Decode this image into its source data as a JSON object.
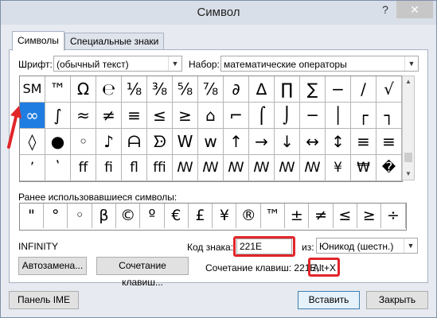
{
  "window": {
    "title": "Символ",
    "help": "?",
    "close": "✕"
  },
  "tabs": [
    {
      "label": "Символы"
    },
    {
      "label": "Специальные знаки"
    }
  ],
  "font": {
    "label": "Шрифт:",
    "value": "(обычный текст)"
  },
  "subset": {
    "label": "Набор:",
    "value": "математические операторы"
  },
  "grid": {
    "rows": [
      [
        "SM",
        "™",
        "Ω",
        "℮",
        "⅛",
        "⅜",
        "⅝",
        "⅞",
        "∂",
        "∆",
        "∏",
        "∑",
        "−",
        "∕",
        "√"
      ],
      [
        "∞",
        "∫",
        "≈",
        "≠",
        "≡",
        "≤",
        "≥",
        "⌂",
        "⌐",
        "⌠",
        "⌡",
        "─",
        "│",
        "┌",
        "┐"
      ],
      [
        "└",
        "┘",
        "├",
        "┤",
        "┬",
        "┴",
        "┼",
        "═",
        "║",
        "╒",
        "╓",
        "╔",
        "╕",
        "╖",
        "╗"
      ],
      [
        "◊",
        "●",
        "◦",
        "♪",
        "ᗩ",
        "ᗦ",
        "W",
        "w",
        "↑",
        "→",
        "↓",
        "↔",
        "↕",
        "≡",
        "≡"
      ],
      [
        "ʼ",
        "ʽ",
        "ff",
        "fi",
        "fl",
        "ffi",
        "ꟿ",
        "ꟿ",
        "ꟿ",
        "ꟿ",
        "ꟿ",
        "ꟿ",
        "¥",
        "₩",
        "�"
      ]
    ],
    "selected": "∞"
  },
  "recent": {
    "label": "Ранее использовавшиеся символы:",
    "items": [
      "\"",
      "°",
      "◦",
      "β",
      "©",
      "º",
      "€",
      "£",
      "¥",
      "®",
      "™",
      "±",
      "≠",
      "≤",
      "≥",
      "÷"
    ]
  },
  "char_name": "INFINITY",
  "code": {
    "label": "Код знака:",
    "value": "221E"
  },
  "from": {
    "label": "из:",
    "value": "Юникод (шестн.)"
  },
  "shortcut": {
    "label": "Сочетание клавиш: 221E,",
    "value": "Alt+X"
  },
  "buttons": {
    "autocorrect": "Автозамена...",
    "shortcut_key": "Сочетание клавиш...",
    "ime": "Панель IME",
    "insert": "Вставить",
    "close": "Закрыть"
  },
  "colors": {
    "selected": "#1f7de2",
    "highlight": "#e1262a",
    "arrow": "#e1262a"
  }
}
